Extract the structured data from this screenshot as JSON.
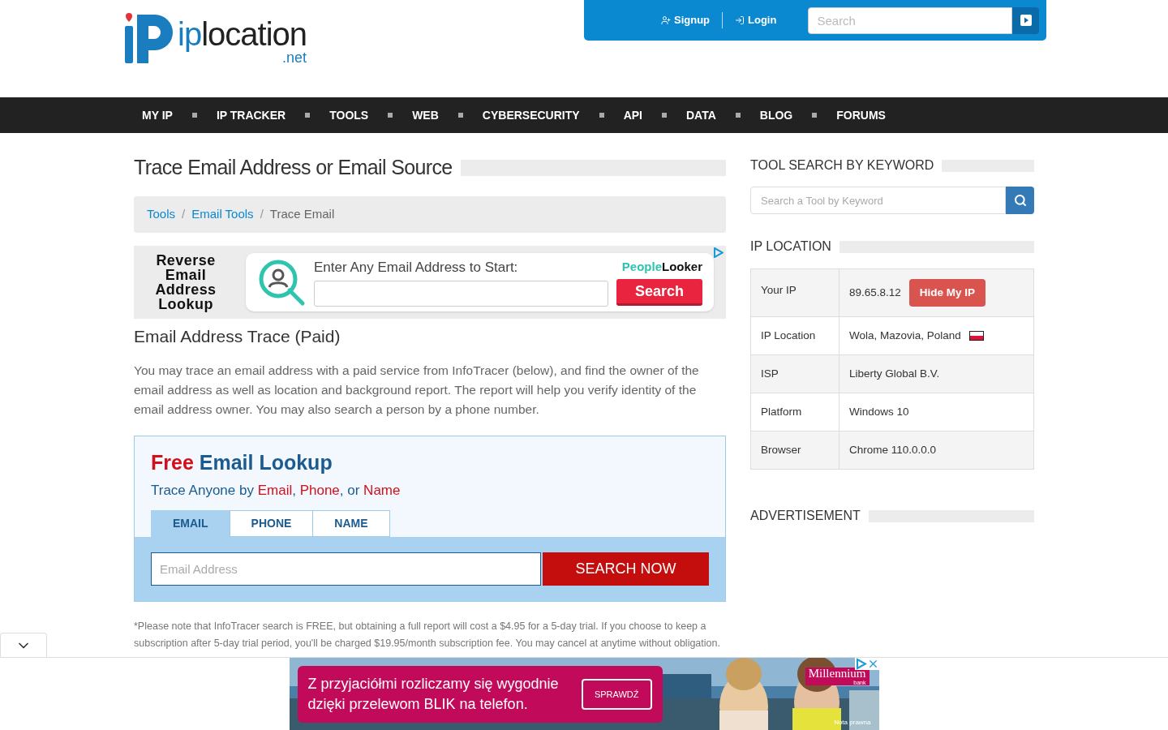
{
  "header": {
    "logo": {
      "name": "iplocation",
      "suffix": ".net"
    },
    "links": [
      {
        "kind": "signup",
        "label": "Signup"
      },
      {
        "kind": "login",
        "label": "Login"
      }
    ],
    "search": {
      "placeholder": "Search"
    }
  },
  "nav": [
    "MY IP",
    "IP TRACKER",
    "TOOLS",
    "WEB",
    "CYBERSECURITY",
    "API",
    "DATA",
    "BLOG",
    "FORUMS"
  ],
  "main": {
    "title": "Trace Email Address or Email Source",
    "breadcrumb_separator": "/",
    "breadcrumb": [
      {
        "label": "Tools",
        "link": true
      },
      {
        "label": "Email Tools",
        "link": true
      },
      {
        "label": "Trace Email",
        "link": false
      }
    ],
    "ad": {
      "heading": "Reverse Email Address Lookup",
      "prompt": "Enter Any Email Address to Start:",
      "brand": [
        "People",
        "Looker"
      ],
      "button": "Search"
    },
    "section_title": "Email Address Trace (Paid)",
    "paragraph": "You may trace an email address with a paid service from InfoTracer (below), and find the owner of the email address as well as location and background report. The report will help you verify identity of the email address owner. You may also search a person by a phone number.",
    "lookup": {
      "title": [
        {
          "text": "Free",
          "accent": true
        },
        {
          "text": " Email Lookup",
          "accent": false
        }
      ],
      "subtitle": [
        {
          "text": "Trace Anyone by ",
          "accent": false
        },
        {
          "text": "Email",
          "accent": true
        },
        {
          "text": ", ",
          "accent": false
        },
        {
          "text": "Phone",
          "accent": true
        },
        {
          "text": ", or ",
          "accent": false
        },
        {
          "text": "Name",
          "accent": true
        }
      ],
      "tabs": [
        {
          "label": "EMAIL",
          "selected": true
        },
        {
          "label": "PHONE",
          "selected": false
        },
        {
          "label": "NAME",
          "selected": false
        }
      ],
      "field": {
        "placeholder": "Email Address"
      },
      "button": "SEARCH NOW"
    },
    "note": "*Please note that InfoTracer search is FREE, but obtaining a full report will cost a $4.95 for a 5-day trial. If you choose to keep a subscription after 5-day trial period, you'll be charged $19.95/month subscription fee. You may cancel at anytime without obligation."
  },
  "sidebar": {
    "tool_search": {
      "title": "TOOL SEARCH BY KEYWORD",
      "placeholder": "Search a Tool by Keyword"
    },
    "ip_location": {
      "title": "IP LOCATION",
      "rows": [
        {
          "label": "Your IP",
          "value": "89.65.8.12",
          "button": "Hide My IP"
        },
        {
          "label": "IP Location",
          "value": "Wola, Mazovia, Poland",
          "flag": true
        },
        {
          "label": "ISP",
          "value": "Liberty Global B.V."
        },
        {
          "label": "Platform",
          "value": "Windows 10"
        },
        {
          "label": "Browser",
          "value": "Chrome 110.0.0.0"
        }
      ]
    },
    "advertisement": {
      "title": "ADVERTISEMENT"
    }
  },
  "bottom_ad": {
    "text": "Z przyjaciółmi rozliczamy się wygodnie dzięki przelewom BLIK na telefon.",
    "button": "SPRAWDŹ",
    "brand": "Millennium",
    "brand_sub": "bank",
    "legal": "Nota prawna"
  }
}
